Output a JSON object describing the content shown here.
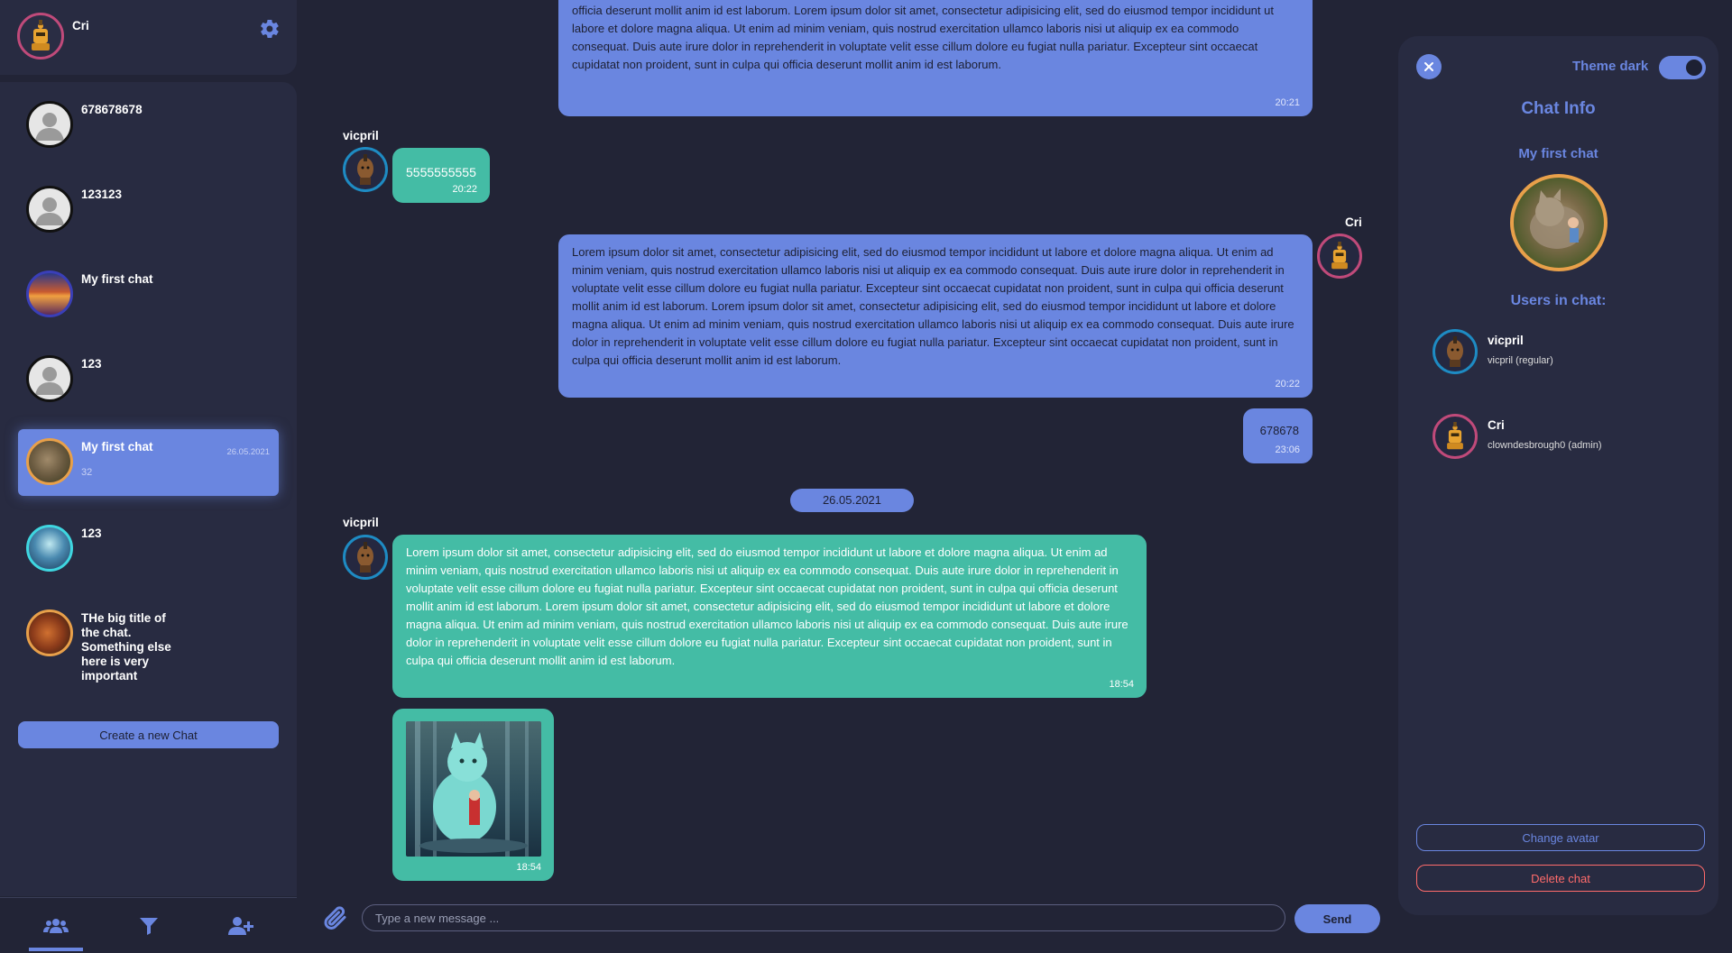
{
  "user": {
    "name": "Cri"
  },
  "sidebar": {
    "chats": [
      {
        "title": "678678678"
      },
      {
        "title": "123123"
      },
      {
        "title": "My first chat"
      },
      {
        "title": "123"
      },
      {
        "title": "My first chat",
        "subtitle": "32",
        "date": "26.05.2021",
        "active": true
      },
      {
        "title": "123"
      },
      {
        "title": "THe big title of the chat. Something else here is very important"
      }
    ],
    "create_button": "Create a new Chat"
  },
  "messages": {
    "m1_text": "reprehenderit in voluptate velit esse cillum dolore eu fugiat nulla pariatur. Excepteur sint occaecat cupidatat non proident, sunt in culpa qui officia deserunt mollit anim id est laborum. Lorem ipsum dolor sit amet, consectetur adipisicing elit, sed do eiusmod tempor incididunt ut labore et dolore magna aliqua. Ut enim ad minim veniam, quis nostrud exercitation ullamco laboris nisi ut aliquip ex ea commodo consequat. Duis aute irure dolor in reprehenderit in voluptate velit esse cillum dolore eu fugiat nulla pariatur. Excepteur sint occaecat cupidatat non proident, sunt in culpa qui officia deserunt mollit anim id est laborum.",
    "m1_time": "20:21",
    "m2_sender": "vicpril",
    "m2_text": "5555555555",
    "m2_time": "20:22",
    "m3_sender": "Cri",
    "m3_text": "Lorem ipsum dolor sit amet, consectetur adipisicing elit, sed do eiusmod tempor incididunt ut labore et dolore magna aliqua. Ut enim ad minim veniam, quis nostrud exercitation ullamco laboris nisi ut aliquip ex ea commodo consequat. Duis aute irure dolor in reprehenderit in voluptate velit esse cillum dolore eu fugiat nulla pariatur. Excepteur sint occaecat cupidatat non proident, sunt in culpa qui officia deserunt mollit anim id est laborum. Lorem ipsum dolor sit amet, consectetur adipisicing elit, sed do eiusmod tempor incididunt ut labore et dolore magna aliqua. Ut enim ad minim veniam, quis nostrud exercitation ullamco laboris nisi ut aliquip ex ea commodo consequat. Duis aute irure dolor in reprehenderit in voluptate velit esse cillum dolore eu fugiat nulla pariatur. Excepteur sint occaecat cupidatat non proident, sunt in culpa qui officia deserunt mollit anim id est laborum.",
    "m3_time": "20:22",
    "m4_text": "678678",
    "m4_time": "23:06",
    "date_divider": "26.05.2021",
    "m5_sender": "vicpril",
    "m5_text": "Lorem ipsum dolor sit amet, consectetur adipisicing elit, sed do eiusmod tempor incididunt ut labore et dolore magna aliqua. Ut enim ad minim veniam, quis nostrud exercitation ullamco laboris nisi ut aliquip ex ea commodo consequat. Duis aute irure dolor in reprehenderit in voluptate velit esse cillum dolore eu fugiat nulla pariatur. Excepteur sint occaecat cupidatat non proident, sunt in culpa qui officia deserunt mollit anim id est laborum. Lorem ipsum dolor sit amet, consectetur adipisicing elit, sed do eiusmod tempor incididunt ut labore et dolore magna aliqua. Ut enim ad minim veniam, quis nostrud exercitation ullamco laboris nisi ut aliquip ex ea commodo consequat. Duis aute irure dolor in reprehenderit in voluptate velit esse cillum dolore eu fugiat nulla pariatur. Excepteur sint occaecat cupidatat non proident, sunt in culpa qui officia deserunt mollit anim id est laborum.",
    "m5_time": "18:54",
    "m6_time": "18:54"
  },
  "composer": {
    "placeholder": "Type a new message ...",
    "send_label": "Send"
  },
  "info_panel": {
    "theme_label": "Theme dark",
    "title": "Chat Info",
    "chat_name": "My first chat",
    "users_heading": "Users in chat:",
    "users": [
      {
        "name": "vicpril",
        "detail": "vicpril (regular)"
      },
      {
        "name": "Cri",
        "detail": "clowndesbrough0 (admin)"
      }
    ],
    "change_avatar": "Change avatar",
    "delete_chat": "Delete chat"
  },
  "icons": {
    "settings": "gear-icon",
    "users": "users-icon",
    "filter": "filter-icon",
    "add_user": "user-plus-icon",
    "attach": "paperclip-icon",
    "close": "close-icon"
  },
  "colors": {
    "background": "#222436",
    "panel": "#282b41",
    "accent": "#6a86e0",
    "green_bubble": "#44bca5",
    "danger": "#ff6b6b",
    "ring_pink": "#c04a7a",
    "ring_blue": "#1e8bc3",
    "ring_orange": "#e8a04a"
  }
}
